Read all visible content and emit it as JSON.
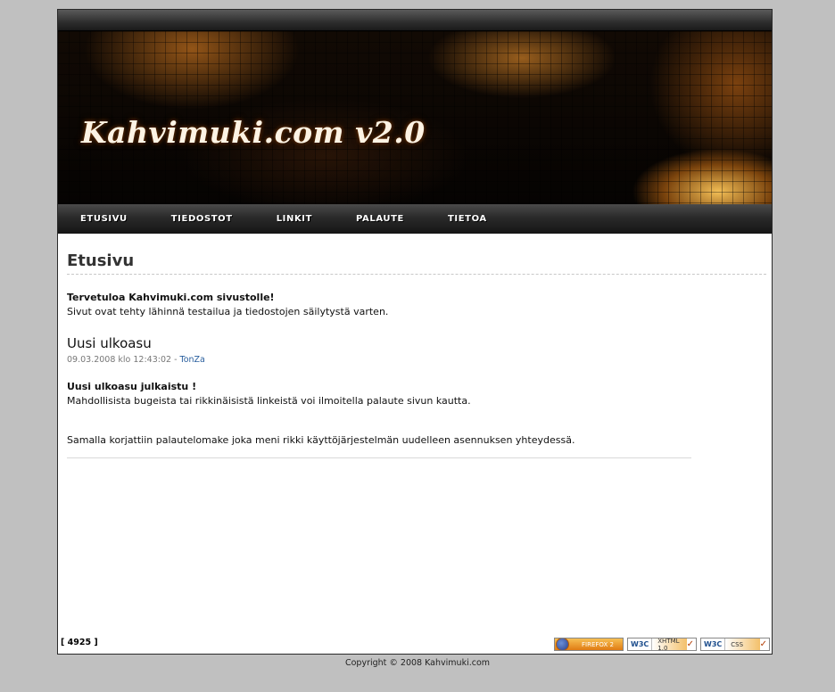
{
  "header": {
    "site_title": "Kahvimuki.com v2.0"
  },
  "nav": {
    "items": [
      {
        "label": "ETUSIVU"
      },
      {
        "label": "TIEDOSTOT"
      },
      {
        "label": "LINKIT"
      },
      {
        "label": "PALAUTE"
      },
      {
        "label": "TIETOA"
      }
    ]
  },
  "main": {
    "page_title": "Etusivu",
    "intro_heading": "Tervetuloa Kahvimuki.com sivustolle!",
    "intro_text": "Sivut ovat tehty lähinnä testailua ja tiedostojen säilytystä varten.",
    "news": {
      "title": "Uusi ulkoasu",
      "date": "09.03.2008 klo 12:43:02",
      "separator": " - ",
      "author": "TonZa",
      "body_heading": "Uusi ulkoasu julkaistu !",
      "body_line1": "Mahdollisista bugeista tai rikkinäisistä linkeistä voi ilmoitella palaute sivun kautta.",
      "body_line2": "Samalla korjattiin palautelomake joka meni rikki käyttöjärjestelmän uudelleen asennuksen yhteydessä."
    }
  },
  "counter": "[ 4925 ]",
  "badges": {
    "firefox": "FIREFOX 2",
    "w3c": "W3C",
    "xhtml": "XHTML 1.0",
    "css": "CSS"
  },
  "footer": {
    "copyright": "Copyright © 2008 Kahvimuki.com"
  }
}
